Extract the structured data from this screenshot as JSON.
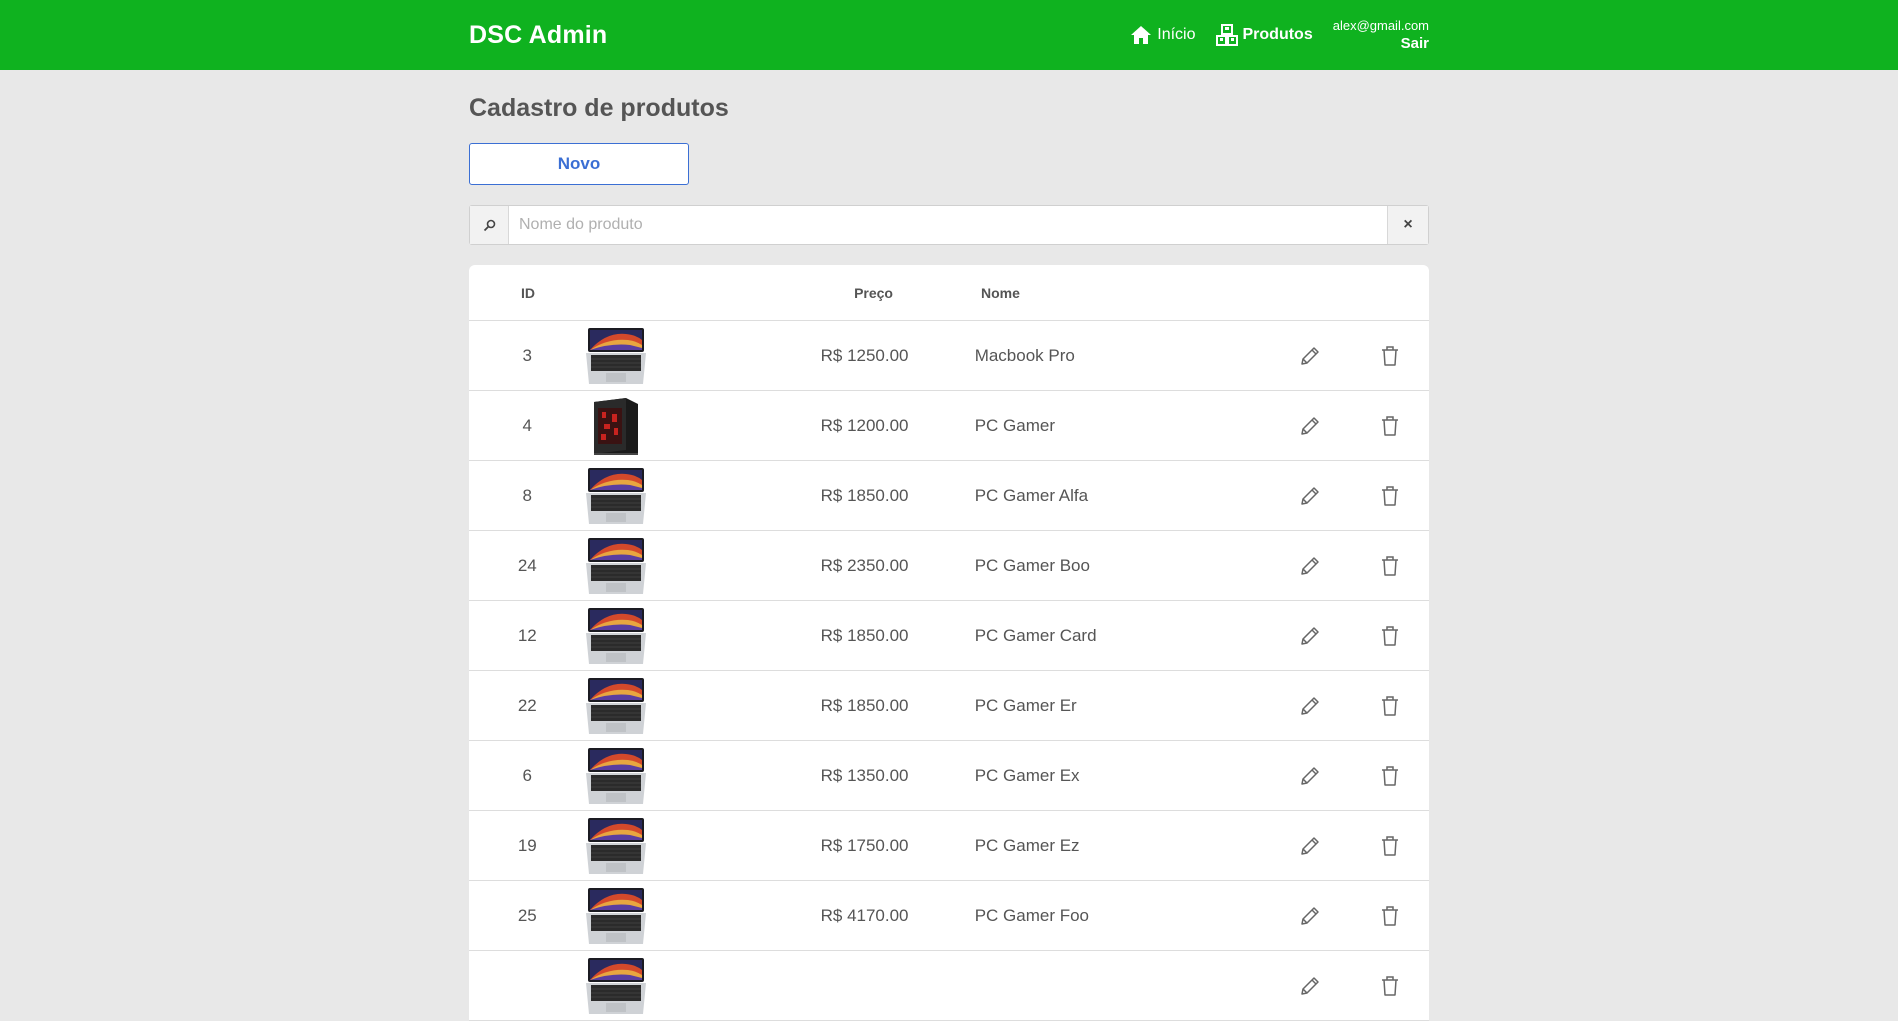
{
  "navbar": {
    "brand": "DSC Admin",
    "links": [
      {
        "label": "Início",
        "icon": "home-icon"
      },
      {
        "label": "Produtos",
        "icon": "products-icon"
      }
    ],
    "user_email": "alex@gmail.com",
    "logout_label": "Sair"
  },
  "page": {
    "title": "Cadastro de produtos",
    "new_button": "Novo"
  },
  "search": {
    "placeholder": "Nome do produto",
    "value": "",
    "clear_label": "×"
  },
  "table": {
    "headers": {
      "id": "ID",
      "price": "Preço",
      "name": "Nome"
    },
    "rows": [
      {
        "id": "3",
        "price": "R$ 1250.00",
        "name": "Macbook Pro",
        "image": "laptop"
      },
      {
        "id": "4",
        "price": "R$ 1200.00",
        "name": "PC Gamer",
        "image": "pc-tower"
      },
      {
        "id": "8",
        "price": "R$ 1850.00",
        "name": "PC Gamer Alfa",
        "image": "laptop"
      },
      {
        "id": "24",
        "price": "R$ 2350.00",
        "name": "PC Gamer Boo",
        "image": "laptop"
      },
      {
        "id": "12",
        "price": "R$ 1850.00",
        "name": "PC Gamer Card",
        "image": "laptop"
      },
      {
        "id": "22",
        "price": "R$ 1850.00",
        "name": "PC Gamer Er",
        "image": "laptop"
      },
      {
        "id": "6",
        "price": "R$ 1350.00",
        "name": "PC Gamer Ex",
        "image": "laptop"
      },
      {
        "id": "19",
        "price": "R$ 1750.00",
        "name": "PC Gamer Ez",
        "image": "laptop"
      },
      {
        "id": "25",
        "price": "R$ 4170.00",
        "name": "PC Gamer Foo",
        "image": "laptop"
      },
      {
        "id": "",
        "price": "",
        "name": "",
        "image": "laptop"
      }
    ]
  },
  "colors": {
    "navbar": "#0fb21f",
    "background": "#e8e8e8",
    "primary": "#3b6fd4"
  }
}
